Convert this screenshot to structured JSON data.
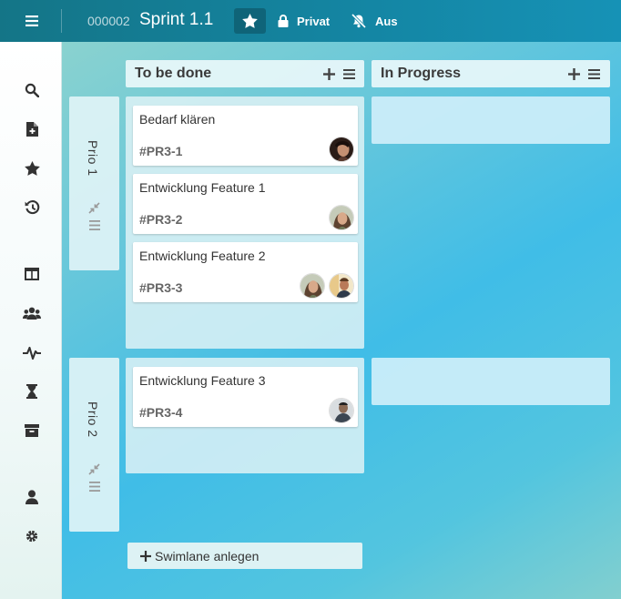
{
  "header": {
    "board_number": "000002",
    "board_title": "Sprint 1.1",
    "private_label": "Privat",
    "notifications_label": "Aus"
  },
  "sidebar": {
    "icons": [
      "search-icon",
      "new-file-icon",
      "star-icon",
      "history-icon",
      "board-icon",
      "team-icon",
      "activity-icon",
      "hourglass-icon",
      "archive-icon",
      "user-icon",
      "settings-icon"
    ]
  },
  "columns": [
    {
      "title": "To be done"
    },
    {
      "title": "In Progress"
    }
  ],
  "swimlanes": [
    {
      "label": "Prio 1"
    },
    {
      "label": "Prio 2"
    }
  ],
  "cards": [
    {
      "title": "Bedarf klären",
      "id": "#PR3-1"
    },
    {
      "title": "Entwicklung Feature 1",
      "id": "#PR3-2"
    },
    {
      "title": "Entwicklung Feature 2",
      "id": "#PR3-3"
    },
    {
      "title": "Entwicklung Feature 3",
      "id": "#PR3-4"
    }
  ],
  "add_swimlane_label": "Swimlane anlegen",
  "colors": {
    "topbar": "#147587",
    "accent": "#1692b6",
    "card_text": "#333333",
    "card_id": "#666666"
  }
}
